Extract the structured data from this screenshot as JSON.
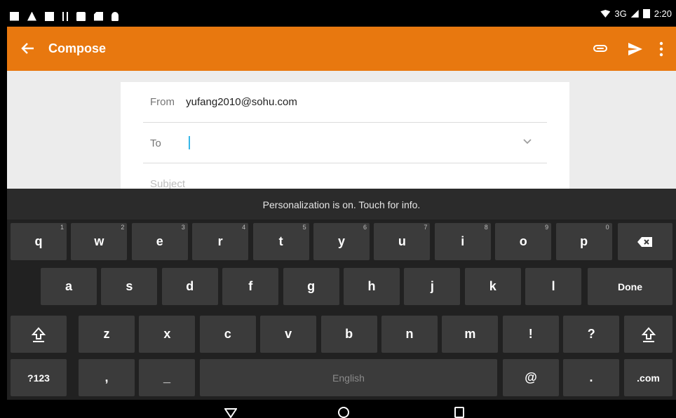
{
  "status": {
    "network": "3G",
    "time": "2:20",
    "icons": [
      "mail-icon",
      "warning-icon",
      "image-icon",
      "usb-icon",
      "lock-icon",
      "sd-card-icon",
      "android-icon",
      "wifi-icon",
      "signal-icon",
      "battery-icon"
    ]
  },
  "appbar": {
    "title": "Compose",
    "color": "#e8780f",
    "back_icon": "arrow-left-icon",
    "attach_icon": "paperclip-icon",
    "send_icon": "send-icon",
    "more_icon": "more-vertical-icon"
  },
  "compose": {
    "from_label": "From",
    "from_value": "yufang2010@sohu.com",
    "to_label": "To",
    "to_value": "",
    "subject_placeholder": "Subject"
  },
  "keyboard": {
    "suggestion": "Personalization is on. Touch for info.",
    "row1": [
      {
        "label": "q",
        "hint": "1"
      },
      {
        "label": "w",
        "hint": "2"
      },
      {
        "label": "e",
        "hint": "3"
      },
      {
        "label": "r",
        "hint": "4"
      },
      {
        "label": "t",
        "hint": "5"
      },
      {
        "label": "y",
        "hint": "6"
      },
      {
        "label": "u",
        "hint": "7"
      },
      {
        "label": "i",
        "hint": "8"
      },
      {
        "label": "o",
        "hint": "9"
      },
      {
        "label": "p",
        "hint": "0"
      }
    ],
    "row2": [
      "a",
      "s",
      "d",
      "f",
      "g",
      "h",
      "j",
      "k",
      "l"
    ],
    "done_label": "Done",
    "row3": [
      "z",
      "x",
      "c",
      "v",
      "b",
      "n",
      "m",
      "!",
      "?"
    ],
    "symbols_label": "?123",
    "comma_label": ",",
    "dash_label": "_",
    "space_label": "English",
    "at_label": "@",
    "period_label": ".",
    "dotcom_label": ".com",
    "backspace_icon": "backspace-icon",
    "shift_icon": "shift-icon"
  },
  "navbar": {
    "icons": [
      "nav-back-icon",
      "nav-home-icon",
      "nav-recents-icon"
    ]
  }
}
